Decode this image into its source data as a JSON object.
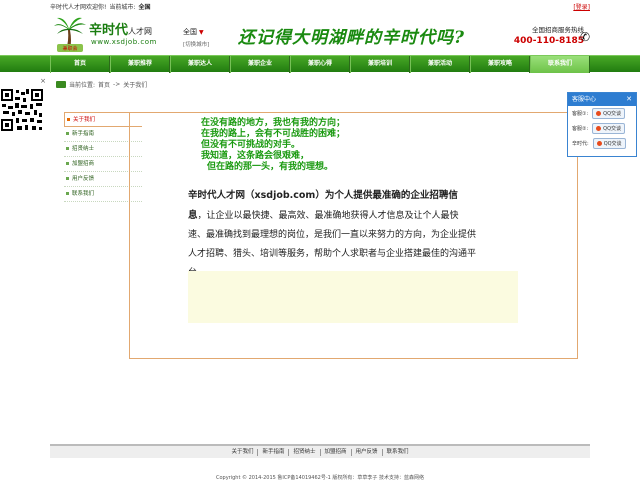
{
  "topbar": {
    "welcome": "辛时代人才网欢迎你!",
    "city_label": "当前城市:",
    "city": "全国",
    "login": "[登录]"
  },
  "header": {
    "logo_name": "辛时代",
    "logo_sub": "人才网",
    "logo_url": "www.xsdjob.com",
    "logo_badge": "兼职会",
    "region": "全国",
    "region_switch": "[切换城市]",
    "slogan": "还记得大明湖畔的辛时代吗?",
    "hotline_label": "全国招商服务热线",
    "hotline_number": "400-110-8185"
  },
  "nav": [
    "首页",
    "兼职推荐",
    "兼职达人",
    "兼职企业",
    "兼职心得",
    "兼职培训",
    "兼职活动",
    "兼职攻略",
    "联系我们"
  ],
  "nav_active": 8,
  "breadcrumb": {
    "label": "当前位置:",
    "home": "首页",
    "sep": "->",
    "current": "关于我们"
  },
  "sidebar": [
    "关于我们",
    "新手指南",
    "招贤纳士",
    "加盟招商",
    "用户反馈",
    "联系我们"
  ],
  "sidebar_active": 0,
  "poem": [
    "在没有路的地方，我也有我的方向；",
    "在我的路上，会有不可战胜的困难；",
    "但没有不可挑战的对手。",
    "我知道，这条路会很艰难，",
    "但在路的那一头，有我的理想。"
  ],
  "intro": {
    "lead": "辛时代人才网（xsdjob.com）为个人提供最准确的企业招聘信",
    "lead_end": "息",
    "body": "，让企业以最快捷、最高效、最准确地获得人才信息及让个人最快速、最准确找到最理想的岗位，是我们一直以来努力的方向，为企业提供人才招聘、猎头、培训等服务，帮助个人求职者与企业搭建最佳的沟通平台。"
  },
  "chat": {
    "title": "客服中心",
    "rows": [
      {
        "label": "客服①:",
        "button": "QQ交谈"
      },
      {
        "label": "客服②:",
        "button": "QQ交谈"
      },
      {
        "label": "辛时代:",
        "button": "QQ交谈"
      }
    ]
  },
  "footer": {
    "links": [
      "关于我们",
      "新手指南",
      "招贤纳士",
      "加盟招商",
      "用户反馈",
      "联系我们"
    ],
    "copyright": "Copyright © 2014-2015 鲁ICP备14019462号-1 版权所有：草草李子 技术支持：蓝森网络"
  },
  "colors": {
    "brand_green": "#217c10",
    "slogan_green": "#1a8a10",
    "hotline_red": "#cc0000",
    "chat_blue": "#2e7dd1"
  }
}
